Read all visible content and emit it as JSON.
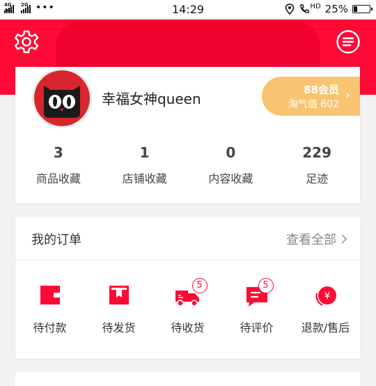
{
  "status_bar": {
    "net_label_1": "4G 4G",
    "net_label_2": "2G",
    "time": "14:29",
    "hd_label": "HD",
    "battery": "25%",
    "battery_level": 0.25
  },
  "profile": {
    "username": "幸福女神queen",
    "vip_title": "88会员",
    "vip_sub": "淘气值 602",
    "stats": [
      {
        "num": "3",
        "label": "商品收藏"
      },
      {
        "num": "1",
        "label": "店铺收藏"
      },
      {
        "num": "0",
        "label": "内容收藏"
      },
      {
        "num": "229",
        "label": "足迹"
      }
    ]
  },
  "orders": {
    "title": "我的订单",
    "view_all": "查看全部",
    "items": [
      {
        "label": "待付款",
        "icon": "wallet-icon",
        "badge": ""
      },
      {
        "label": "待发货",
        "icon": "package-icon",
        "badge": ""
      },
      {
        "label": "待收货",
        "icon": "truck-icon",
        "badge": "5"
      },
      {
        "label": "待评价",
        "icon": "comment-icon",
        "badge": "5"
      },
      {
        "label": "退款/售后",
        "icon": "refund-icon",
        "badge": ""
      }
    ]
  },
  "colors": {
    "brand": "#ff0a36",
    "vip": "#f8c472"
  }
}
